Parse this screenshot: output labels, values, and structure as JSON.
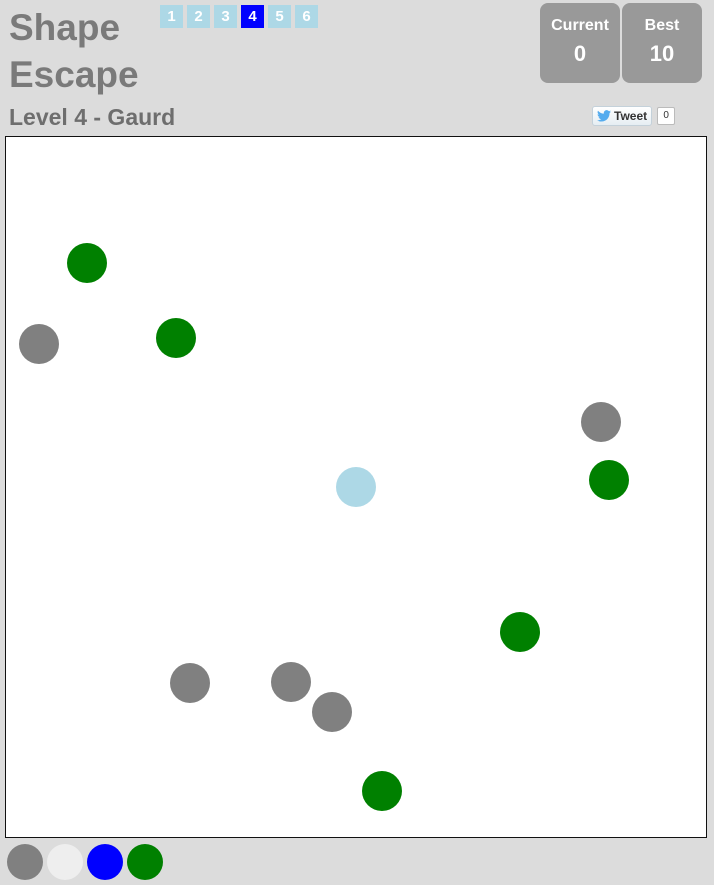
{
  "title": {
    "line1": "Shape",
    "line2": "Escape"
  },
  "levels": [
    {
      "label": "1",
      "active": false
    },
    {
      "label": "2",
      "active": false
    },
    {
      "label": "3",
      "active": false
    },
    {
      "label": "4",
      "active": true
    },
    {
      "label": "5",
      "active": false
    },
    {
      "label": "6",
      "active": false
    }
  ],
  "level_name": "Level 4 - Gaurd",
  "scores": {
    "current_label": "Current",
    "current_value": "0",
    "best_label": "Best",
    "best_value": "10"
  },
  "tweet": {
    "label": "Tweet",
    "count": "0",
    "icon": "twitter-bird-icon"
  },
  "board": {
    "player": {
      "color": "#add8e6"
    },
    "shapes": [
      {
        "color": "#008000"
      },
      {
        "color": "#808080"
      },
      {
        "color": "#008000"
      },
      {
        "color": "#808080"
      },
      {
        "color": "#008000"
      },
      {
        "color": "#008000"
      },
      {
        "color": "#808080"
      },
      {
        "color": "#808080"
      },
      {
        "color": "#808080"
      },
      {
        "color": "#008000"
      }
    ]
  },
  "palette": [
    {
      "name": "gray",
      "color": "#808080"
    },
    {
      "name": "light-gray",
      "color": "#eeeeee"
    },
    {
      "name": "blue",
      "color": "#0000ff"
    },
    {
      "name": "green",
      "color": "#008000"
    }
  ]
}
